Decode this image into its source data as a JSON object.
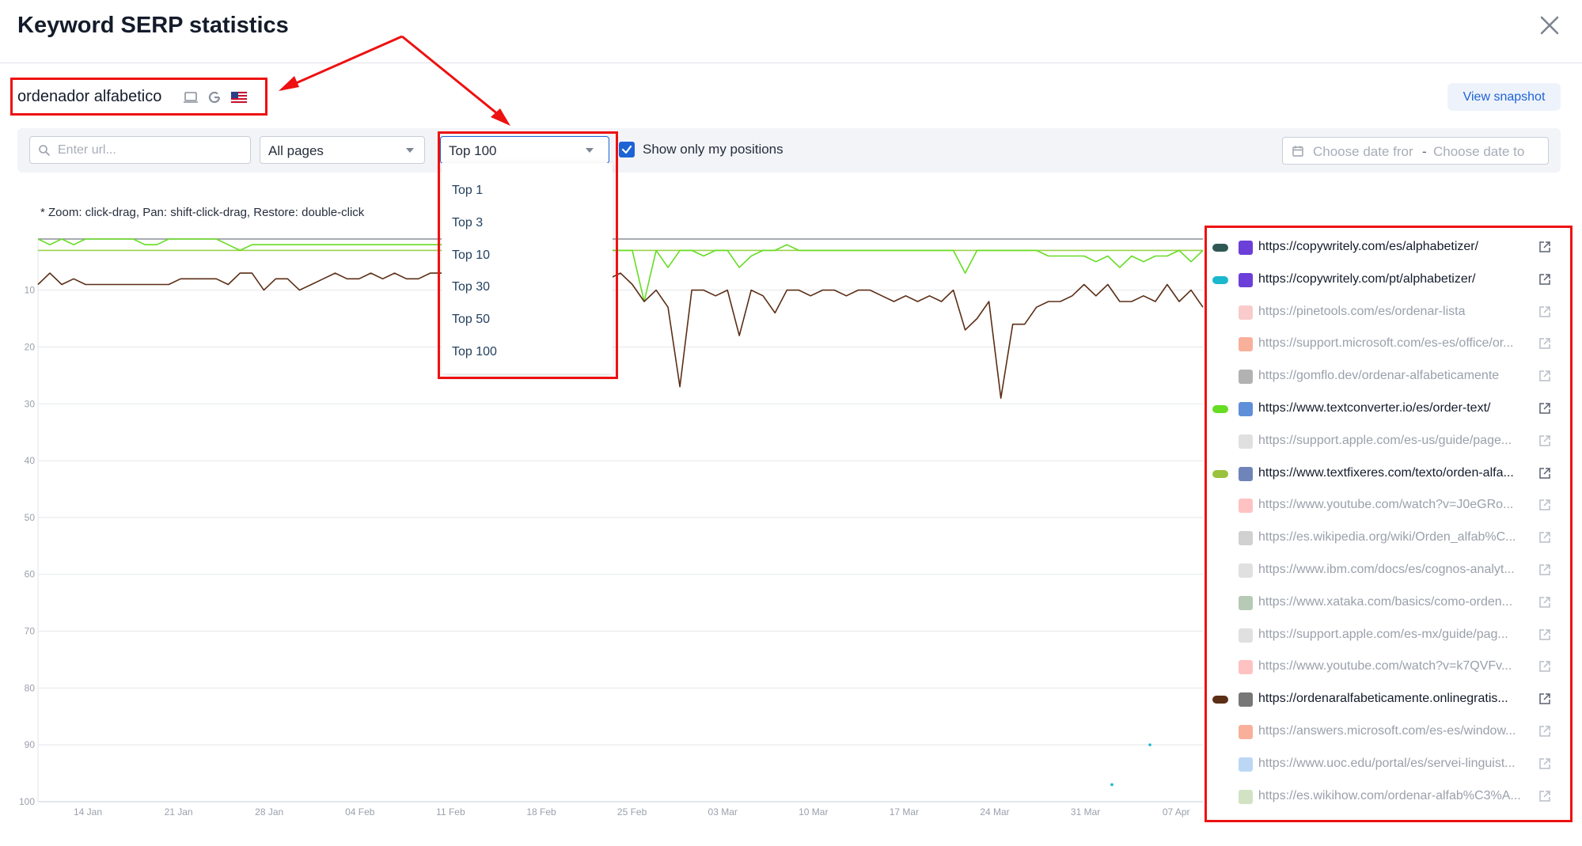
{
  "header": {
    "title": "Keyword SERP statistics"
  },
  "keyword": {
    "text": "ordenador alfabetico",
    "device_icon": "laptop-icon",
    "engine_icon": "google-icon",
    "country_icon": "us-flag-icon"
  },
  "snapshot_label": "View snapshot",
  "toolbar": {
    "url_placeholder": "Enter url...",
    "pages_value": "All pages",
    "top_value": "Top 100",
    "show_mine_label": "Show only my positions",
    "show_mine_checked": true,
    "date_from_placeholder": "Choose date fror",
    "date_separator": "-",
    "date_to_placeholder": "Choose date to"
  },
  "dropdown_options": [
    "Top 1",
    "Top 3",
    "Top 10",
    "Top 30",
    "Top 50",
    "Top 100"
  ],
  "hint": "* Zoom: click-drag, Pan: shift-click-drag, Restore: double-click",
  "chart_data": {
    "type": "line",
    "y_inverted": true,
    "ylim": [
      1,
      100
    ],
    "y_ticks": [
      "10",
      "20",
      "30",
      "40",
      "50",
      "60",
      "70",
      "80",
      "90",
      "100"
    ],
    "x_ticks": [
      "14 Jan",
      "21 Jan",
      "28 Jan",
      "04 Feb",
      "11 Feb",
      "18 Feb",
      "25 Feb",
      "03 Mar",
      "10 Mar",
      "17 Mar",
      "24 Mar",
      "31 Mar",
      "07 Apr"
    ],
    "series": [
      {
        "name": "https://ordenaralfabeticamente.onlinegratis...",
        "color": "#5b2e16",
        "values": [
          9,
          7,
          9,
          8,
          9,
          9,
          9,
          9,
          9,
          9,
          9,
          9,
          8,
          8,
          8,
          8,
          9,
          7,
          7,
          10,
          8,
          8,
          10,
          9,
          8,
          7,
          8,
          8,
          7,
          8,
          7,
          8,
          8,
          7,
          7,
          10,
          8,
          9,
          9,
          8,
          8,
          8,
          8,
          8,
          8,
          8,
          8,
          9,
          8,
          7,
          9,
          12,
          10,
          13,
          27,
          10,
          10,
          11,
          10,
          18,
          10,
          11,
          14,
          10,
          10,
          11,
          10,
          10,
          11,
          10,
          10,
          11,
          12,
          11,
          12,
          11,
          12,
          10,
          17,
          15,
          12,
          29,
          16,
          16,
          13,
          12,
          12,
          11,
          9,
          11,
          9,
          12,
          12,
          11,
          12,
          9,
          12,
          10,
          13
        ]
      },
      {
        "name": "https://www.textconverter.io/es/order-text/",
        "color": "#66dd22",
        "values": [
          1,
          2,
          1,
          2,
          1,
          1,
          1,
          1,
          1,
          2,
          2,
          1,
          1,
          1,
          1,
          1,
          2,
          3,
          2,
          2,
          2,
          2,
          2,
          2,
          2,
          2,
          2,
          2,
          2,
          2,
          2,
          2,
          2,
          2,
          2,
          3,
          2,
          2,
          2,
          2,
          2,
          2,
          2,
          2,
          2,
          2,
          2,
          3,
          3,
          3,
          3,
          12,
          3,
          6,
          3,
          3,
          4,
          3,
          3,
          6,
          4,
          3,
          3,
          2,
          3,
          3,
          3,
          3,
          3,
          3,
          3,
          3,
          3,
          3,
          3,
          3,
          3,
          3,
          7,
          3,
          3,
          3,
          3,
          3,
          3,
          4,
          4,
          4,
          4,
          5,
          4,
          6,
          4,
          5,
          4,
          4,
          3,
          5,
          3
        ]
      },
      {
        "name": "https://www.textfixeres.com/texto/orden-alfa...",
        "color": "#9ad14a",
        "values": [
          3,
          3,
          3,
          3,
          3,
          3,
          3,
          3,
          3,
          3,
          3,
          3,
          3,
          3,
          3,
          3,
          3,
          3,
          3,
          3,
          3,
          3,
          3,
          3,
          3,
          3,
          3,
          3,
          3,
          3,
          3,
          3,
          3,
          3,
          3,
          3,
          3,
          3,
          3,
          3,
          3,
          3,
          3,
          3,
          3,
          3,
          3,
          3,
          3,
          3,
          3,
          3,
          3,
          3,
          3,
          3,
          3,
          3,
          3,
          3,
          3,
          3,
          3,
          3,
          3,
          3,
          3,
          3,
          3,
          3,
          3,
          3,
          3,
          3,
          3,
          3,
          3,
          3,
          3,
          3,
          3,
          3,
          3,
          3,
          3,
          3,
          3,
          3,
          3,
          3,
          3,
          3,
          3,
          3,
          3,
          3,
          3,
          3,
          3
        ]
      }
    ],
    "points": [
      {
        "x": "04 Apr",
        "y": 90,
        "color": "#1bb7cc"
      },
      {
        "x": "01 Apr",
        "y": 97,
        "color": "#1bb7cc"
      }
    ]
  },
  "legend": [
    {
      "url": "https://copywritely.com/es/alphabetizer/",
      "active": true,
      "color": "#2f5855",
      "favicon": "copywritely-icon",
      "fav_color": "#6b3fd8"
    },
    {
      "url": "https://copywritely.com/pt/alphabetizer/",
      "active": true,
      "color": "#1bb7cc",
      "favicon": "copywritely-icon",
      "fav_color": "#6b3fd8"
    },
    {
      "url": "https://pinetools.com/es/ordenar-lista",
      "active": false,
      "color": "",
      "favicon": "pinetools-icon",
      "fav_color": "#f28c8c"
    },
    {
      "url": "https://support.microsoft.com/es-es/office/or...",
      "active": false,
      "color": "",
      "favicon": "microsoft-icon",
      "fav_color": "#f25022"
    },
    {
      "url": "https://gomflo.dev/ordenar-alfabeticamente",
      "active": false,
      "color": "",
      "favicon": "gomflo-icon",
      "fav_color": "#555555"
    },
    {
      "url": "https://www.textconverter.io/es/order-text/",
      "active": true,
      "color": "#66dd22",
      "favicon": "textconverter-icon",
      "fav_color": "#5f8fd8"
    },
    {
      "url": "https://support.apple.com/es-us/guide/page...",
      "active": false,
      "color": "",
      "favicon": "apple-icon",
      "fav_color": "#bbbbbb"
    },
    {
      "url": "https://www.textfixeres.com/texto/orden-alfa...",
      "active": true,
      "color": "#9ac23c",
      "favicon": "globe-icon",
      "fav_color": "#6f84b8"
    },
    {
      "url": "https://www.youtube.com/watch?v=J0eGRo...",
      "active": false,
      "color": "",
      "favicon": "youtube-icon",
      "fav_color": "#ff7777"
    },
    {
      "url": "https://es.wikipedia.org/wiki/Orden_alfab%C...",
      "active": false,
      "color": "",
      "favicon": "wikipedia-icon",
      "fav_color": "#999999"
    },
    {
      "url": "https://www.ibm.com/docs/es/cognos-analyt...",
      "active": false,
      "color": "",
      "favicon": "ibm-icon",
      "fav_color": "#bbbbbb"
    },
    {
      "url": "https://www.xataka.com/basics/como-orden...",
      "active": false,
      "color": "",
      "favicon": "xataka-icon",
      "fav_color": "#5d8a5a"
    },
    {
      "url": "https://support.apple.com/es-mx/guide/pag...",
      "active": false,
      "color": "",
      "favicon": "apple-icon",
      "fav_color": "#bbbbbb"
    },
    {
      "url": "https://www.youtube.com/watch?v=k7QVFv...",
      "active": false,
      "color": "",
      "favicon": "youtube-icon",
      "fav_color": "#ff7777"
    },
    {
      "url": "https://ordenaralfabeticamente.onlinegratis...",
      "active": true,
      "color": "#5b2e16",
      "favicon": "elephant-icon",
      "fav_color": "#777777"
    },
    {
      "url": "https://answers.microsoft.com/es-es/window...",
      "active": false,
      "color": "",
      "favicon": "microsoft-icon",
      "fav_color": "#f25022"
    },
    {
      "url": "https://www.uoc.edu/portal/es/servei-linguist...",
      "active": false,
      "color": "",
      "favicon": "uoc-icon",
      "fav_color": "#6aa6e8"
    },
    {
      "url": "https://es.wikihow.com/ordenar-alfab%C3%A...",
      "active": false,
      "color": "",
      "favicon": "wikihow-icon",
      "fav_color": "#9ac27a"
    }
  ]
}
